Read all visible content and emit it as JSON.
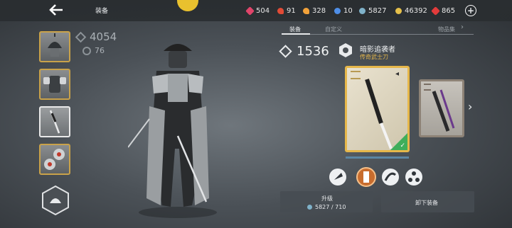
{
  "topbar": {
    "title": "装备",
    "resources": [
      {
        "name": "gem-icon",
        "value": "504",
        "color": "#e0456a"
      },
      {
        "name": "heart-icon",
        "value": "91",
        "color": "#e14b36"
      },
      {
        "name": "flame-icon",
        "value": "328",
        "color": "#f2a23a"
      },
      {
        "name": "water-icon",
        "value": "10",
        "color": "#4f8fe8"
      },
      {
        "name": "orb-icon",
        "value": "5827",
        "color": "#7fb2c9"
      },
      {
        "name": "coin-icon",
        "value": "46392",
        "color": "#e5c04a"
      },
      {
        "name": "ruby-icon",
        "value": "865",
        "color": "#e23b3b"
      }
    ]
  },
  "hero": {
    "power": "4054",
    "sub_power": "76"
  },
  "panel": {
    "tabs": [
      "装备",
      "自定义",
      "物品集"
    ],
    "power": "1536",
    "item_name": "暗影追袭者",
    "item_type": "传奇武士刀",
    "upgrade_label": "升级",
    "upgrade_cost": "5827 / 710",
    "unequip_label": "卸下装备",
    "accent": "#e6b74a",
    "equipped_color": "#3fae5b"
  }
}
